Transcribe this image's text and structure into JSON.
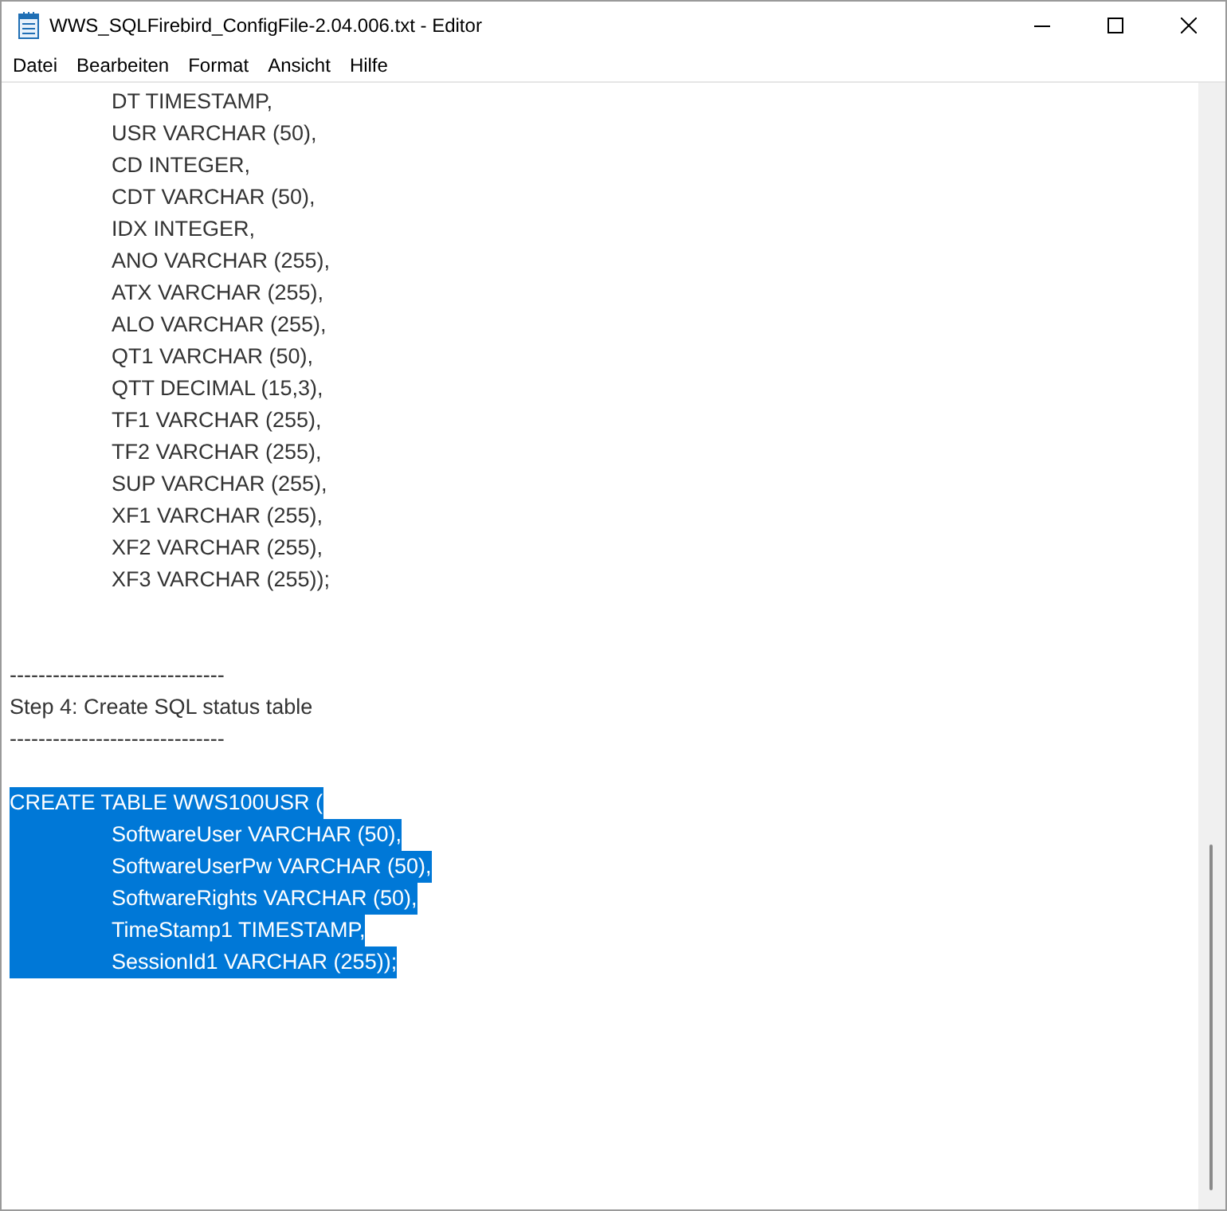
{
  "window": {
    "title": "WWS_SQLFirebird_ConfigFile-2.04.006.txt - Editor"
  },
  "menu": [
    "Datei",
    "Bearbeiten",
    "Format",
    "Ansicht",
    "Hilfe"
  ],
  "blocks": [
    {
      "lines": [
        {
          "text": "\tDT TIMESTAMP,",
          "selected": false
        },
        {
          "text": "\tUSR VARCHAR (50),",
          "selected": false
        },
        {
          "text": "\tCD INTEGER,",
          "selected": false
        },
        {
          "text": "\tCDT VARCHAR (50),",
          "selected": false
        },
        {
          "text": "\tIDX INTEGER,",
          "selected": false
        },
        {
          "text": "\tANO VARCHAR (255),",
          "selected": false
        },
        {
          "text": "\tATX VARCHAR (255),",
          "selected": false
        },
        {
          "text": "\tALO VARCHAR (255),",
          "selected": false
        },
        {
          "text": "\tQT1 VARCHAR (50),",
          "selected": false
        },
        {
          "text": "\tQTT DECIMAL (15,3),",
          "selected": false
        },
        {
          "text": "\tTF1 VARCHAR (255),",
          "selected": false
        },
        {
          "text": "\tTF2 VARCHAR (255),",
          "selected": false
        },
        {
          "text": "\tSUP VARCHAR (255),",
          "selected": false
        },
        {
          "text": "\tXF1 VARCHAR (255),",
          "selected": false
        },
        {
          "text": "\tXF2 VARCHAR (255),",
          "selected": false
        },
        {
          "text": "\tXF3 VARCHAR (255));",
          "selected": false
        }
      ]
    },
    {
      "lines": [
        {
          "text": "------------------------------",
          "selected": false
        },
        {
          "text": "Step 4: Create SQL status table",
          "selected": false
        },
        {
          "text": "------------------------------",
          "selected": false
        }
      ]
    },
    {
      "lines": [
        {
          "text": "CREATE TABLE WWS100USR (",
          "selected": true
        },
        {
          "text": "\tSoftwareUser VARCHAR (50),",
          "selected": true
        },
        {
          "text": "\tSoftwareUserPw VARCHAR (50),",
          "selected": true
        },
        {
          "text": "\tSoftwareRights VARCHAR (50),",
          "selected": true
        },
        {
          "text": "\tTimeStamp1 TIMESTAMP,",
          "selected": true
        },
        {
          "text": "\tSessionId1 VARCHAR (255));",
          "selected": true
        }
      ]
    }
  ]
}
